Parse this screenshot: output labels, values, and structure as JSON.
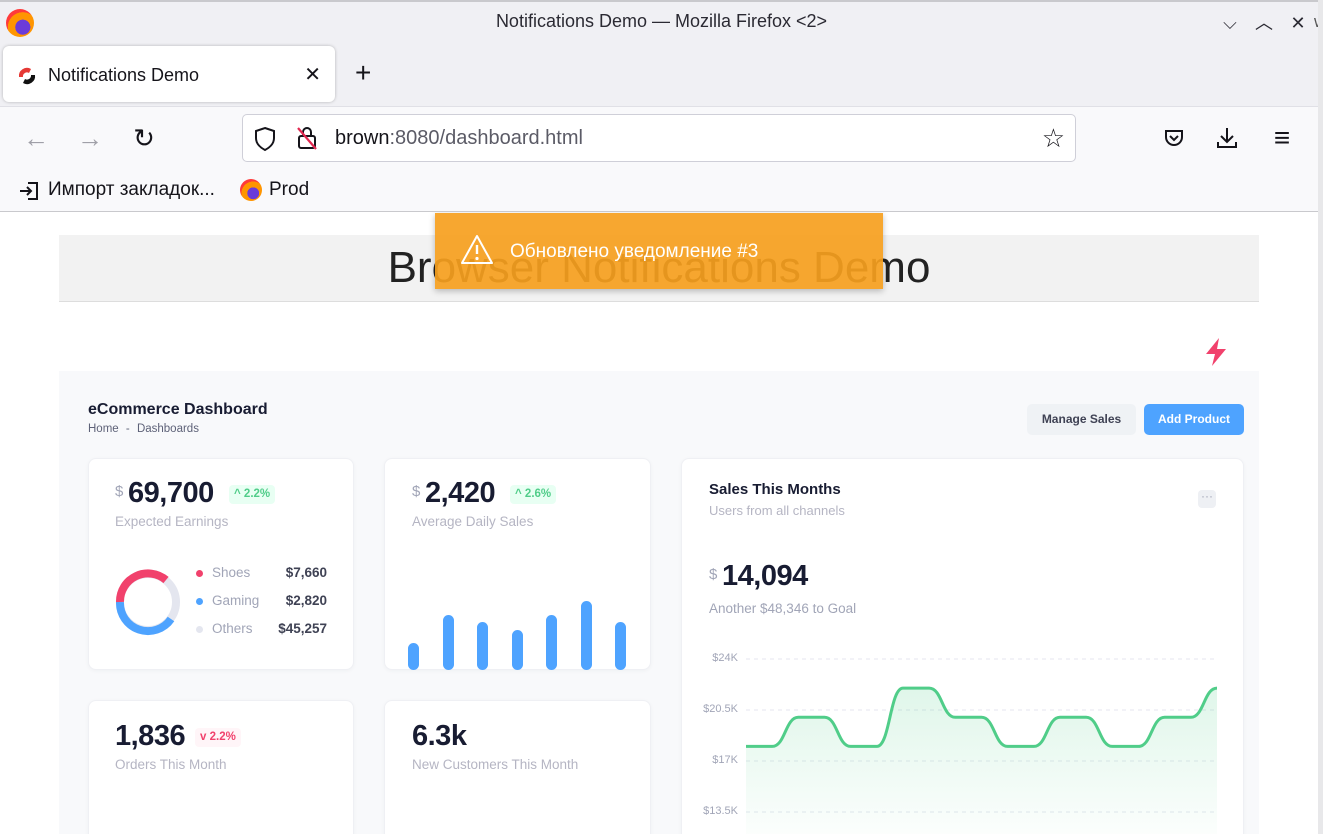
{
  "window": {
    "title": "Notifications Demo — Mozilla Firefox <2>",
    "minimize_glyph": "⌵",
    "maximize_glyph": "︿",
    "close_glyph": "✕",
    "edge_char": "w"
  },
  "tab": {
    "label": "Notifications Demo",
    "close_glyph": "✕",
    "new_tab_glyph": "+"
  },
  "navbar": {
    "back_glyph": "←",
    "forward_glyph": "→",
    "reload_glyph": "↻",
    "url_host": "brown",
    "url_rest": ":8080/dashboard.html",
    "star_glyph": "☆",
    "menu_glyph": "≡"
  },
  "bookmarks": [
    {
      "label": "Импорт закладок...",
      "icon": "import-icon"
    },
    {
      "label": "Prod",
      "icon": "firefox-icon"
    }
  ],
  "page": {
    "banner_title": "Browser Notifications Demo",
    "toast_message": "Обновлено уведомление #3",
    "toast_color": "#f6a01e"
  },
  "dashboard": {
    "title": "eCommerce Dashboard",
    "breadcrumb_home": "Home",
    "breadcrumb_sep": "-",
    "breadcrumb_current": "Dashboards",
    "manage_sales": "Manage Sales",
    "add_product": "Add Product",
    "accent": "#4ea3ff",
    "earnings": {
      "currency": "$",
      "value": "69,700",
      "change": "2.2%",
      "label": "Expected Earnings",
      "legend": [
        {
          "name": "Shoes",
          "value": "$7,660",
          "color": "#f1416c"
        },
        {
          "name": "Gaming",
          "value": "$2,820",
          "color": "#4ea3ff"
        },
        {
          "name": "Others",
          "value": "$45,257",
          "color": "#e4e6ef"
        }
      ]
    },
    "daily_sales": {
      "currency": "$",
      "value": "2,420",
      "change": "2.6%",
      "label": "Average Daily Sales",
      "bar_levels": [
        0.38,
        0.78,
        0.68,
        0.57,
        0.78,
        0.98,
        0.68
      ]
    },
    "orders": {
      "value": "1,836",
      "change": "2.2%",
      "label": "Orders This Month"
    },
    "customers": {
      "value": "6.3k",
      "label": "New Customers This Month"
    },
    "sales_month": {
      "title": "Sales This Months",
      "subtitle": "Users from all channels",
      "more_glyph": "···",
      "currency": "$",
      "value": "14,094",
      "goal": "Another $48,346 to Goal"
    }
  },
  "chart_data": {
    "type": "area",
    "title": "",
    "ylim": [
      13.5,
      25.5
    ],
    "y_tick_labels": [
      "$24K",
      "$20.5K",
      "$17K",
      "$13.5K"
    ],
    "y_ticks": [
      24,
      20.5,
      17,
      13.5
    ],
    "series": [
      {
        "name": "",
        "color": "#50cd89",
        "points": [
          [
            0,
            18
          ],
          [
            1,
            18
          ],
          [
            2,
            20
          ],
          [
            3,
            20
          ],
          [
            4,
            18
          ],
          [
            5,
            18
          ],
          [
            6,
            22
          ],
          [
            7,
            22
          ],
          [
            8,
            20
          ],
          [
            9,
            20
          ],
          [
            10,
            18
          ],
          [
            11,
            18
          ],
          [
            12,
            20
          ],
          [
            13,
            20
          ],
          [
            14,
            18
          ],
          [
            15,
            18
          ],
          [
            16,
            20
          ],
          [
            17,
            20
          ],
          [
            18,
            22
          ]
        ]
      }
    ],
    "grid": true
  }
}
